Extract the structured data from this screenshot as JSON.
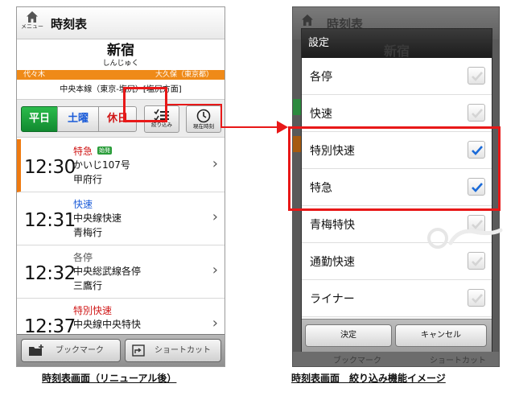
{
  "left": {
    "header": {
      "menu_label": "メニュー",
      "title": "時刻表"
    },
    "station": {
      "name": "新宿",
      "kana": "しんじゅく",
      "prev": "代々木",
      "next": "大久保（東京都）",
      "line": "中央本線（東京-塩尻）[塩尻方面]",
      "line_color": "#ef8a18"
    },
    "days": {
      "weekday": "平日",
      "saturday": "土曜",
      "holiday": "休日"
    },
    "buttons": {
      "filter": "絞り込み",
      "now": "現在時刻"
    },
    "trains": [
      {
        "time": "12:30",
        "type": "特急",
        "badge": "始発",
        "name": "かいじ107号",
        "dest": "甲府行"
      },
      {
        "time": "12:31",
        "type": "快速",
        "badge": "",
        "name": "中央線快速",
        "dest": "青梅行"
      },
      {
        "time": "12:32",
        "type": "各停",
        "badge": "",
        "name": "中央総武線各停",
        "dest": "三鷹行"
      },
      {
        "time": "12:37",
        "type": "特別快速",
        "badge": "",
        "name": "中央線中央特快",
        "dest": ""
      }
    ],
    "footer": {
      "bookmark": "ブックマーク",
      "shortcut": "ショートカット"
    },
    "caption": "時刻表画面（リニューアル後）"
  },
  "right": {
    "bg_title": "時刻表",
    "bg_station": "新宿",
    "dialog_title": "設定",
    "options": [
      {
        "label": "各停",
        "checked": false
      },
      {
        "label": "快速",
        "checked": false
      },
      {
        "label": "特別快速",
        "checked": true
      },
      {
        "label": "特急",
        "checked": true
      },
      {
        "label": "青梅特快",
        "checked": false
      },
      {
        "label": "通勤快速",
        "checked": false
      },
      {
        "label": "ライナー",
        "checked": false
      }
    ],
    "ok": "決定",
    "cancel": "キャンセル",
    "bg_footer": {
      "bookmark": "ブックマーク",
      "shortcut": "ショートカット"
    },
    "caption": "時刻表画面　絞り込み機能イメージ"
  },
  "colors": {
    "highlight": "#e81818",
    "weekday_green": "#1f9e3c",
    "check_blue": "#1a6ad8"
  }
}
